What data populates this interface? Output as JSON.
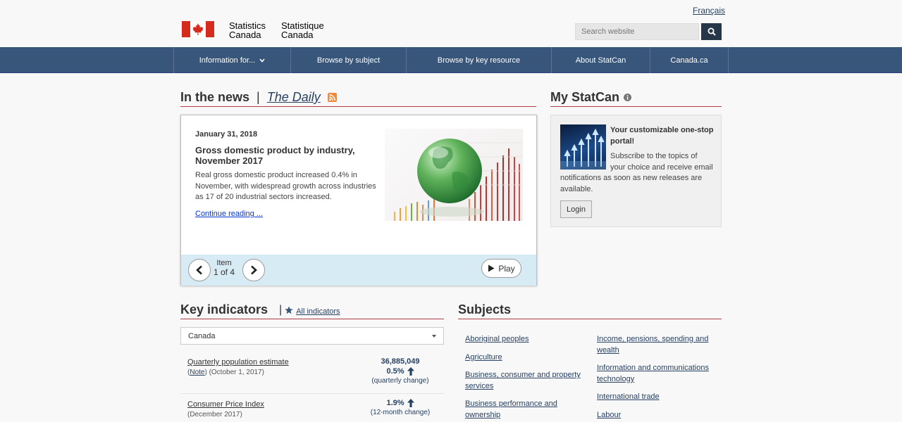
{
  "header": {
    "language_link": "Français",
    "wordmark_en_line1": "Statistics",
    "wordmark_en_line2": "Canada",
    "wordmark_fr_line1": "Statistique",
    "wordmark_fr_line2": "Canada",
    "search_placeholder": "Search website",
    "flag_red": "#d52b1e"
  },
  "nav": {
    "items": [
      {
        "label": "Information for..."
      },
      {
        "label": "Browse by subject"
      },
      {
        "label": "Browse by key resource"
      },
      {
        "label": "About StatCan"
      },
      {
        "label": "Canada.ca"
      }
    ]
  },
  "news": {
    "heading": "In the news",
    "separator": "|",
    "daily_link": "The Daily",
    "date": "January 31, 2018",
    "title": "Gross domestic product by industry, November 2017",
    "body": "Real gross domestic product increased 0.4% in November, with widespread growth across industries as 17 of 20 industrial sectors increased.",
    "link": "Continue reading ...",
    "item_label": "Item",
    "item_count": "1 of 4",
    "play_label": "Play"
  },
  "mystatcan": {
    "heading": "My StatCan",
    "title": "Your customizable one-stop portal!",
    "body_line1": "Subscribe to the topics of",
    "body_line2": "your choice and receive email",
    "body_rest": "notifications as soon as new releases are available.",
    "login_label": "Login"
  },
  "key_indicators": {
    "heading": "Key indicators",
    "separator": "|",
    "all_link": "All indicators",
    "region": "Canada",
    "rows": [
      {
        "label": "Quarterly population estimate",
        "note": "Note",
        "period": "(October 1, 2017)",
        "value": "36,885,049",
        "change": "0.5%",
        "change_note": "(quarterly change)"
      },
      {
        "label": "Consumer Price Index",
        "period": "(December 2017)",
        "change": "1.9%",
        "change_note": "(12-month change)"
      }
    ]
  },
  "subjects": {
    "heading": "Subjects",
    "col1": [
      {
        "label": "Aboriginal peoples"
      },
      {
        "label": "Agriculture"
      },
      {
        "label": "Business, consumer and property services"
      },
      {
        "label": "Business performance and ownership"
      }
    ],
    "col2": [
      {
        "label": "Income, pensions, spending and wealth"
      },
      {
        "label": "Information and communications technology"
      },
      {
        "label": "International trade"
      },
      {
        "label": "Labour"
      }
    ]
  },
  "colors": {
    "nav_bg": "#38557a",
    "accent_rule": "#af3c43",
    "link": "#284162"
  }
}
